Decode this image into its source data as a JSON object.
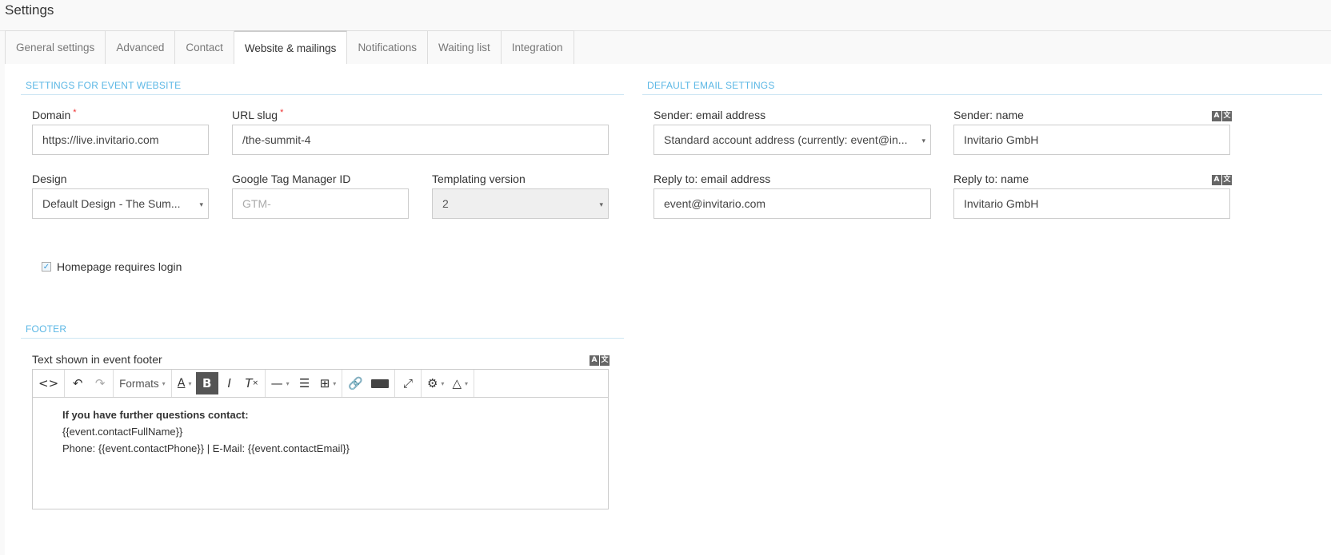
{
  "page": {
    "title": "Settings"
  },
  "tabs": [
    {
      "label": "General settings",
      "active": false
    },
    {
      "label": "Advanced",
      "active": false
    },
    {
      "label": "Contact",
      "active": false
    },
    {
      "label": "Website & mailings",
      "active": true
    },
    {
      "label": "Notifications",
      "active": false
    },
    {
      "label": "Waiting list",
      "active": false
    },
    {
      "label": "Integration",
      "active": false
    }
  ],
  "website": {
    "section_title": "SETTINGS FOR EVENT WEBSITE",
    "domain": {
      "label": "Domain",
      "required_mark": "*",
      "value": "https://live.invitario.com"
    },
    "url_slug": {
      "label": "URL slug",
      "required_mark": "*",
      "value": "/the-summit-4"
    },
    "design": {
      "label": "Design",
      "value": "Default Design - The Sum..."
    },
    "gtm": {
      "label": "Google Tag Manager ID",
      "placeholder": "GTM-"
    },
    "templating": {
      "label": "Templating version",
      "value": "2"
    },
    "homepage_login": {
      "label": "Homepage requires login",
      "checked": true
    }
  },
  "email": {
    "section_title": "DEFAULT EMAIL SETTINGS",
    "sender_email": {
      "label": "Sender: email address",
      "value": "Standard account address (currently: event@in..."
    },
    "sender_name": {
      "label": "Sender: name",
      "value": "Invitario GmbH"
    },
    "reply_email": {
      "label": "Reply to: email address",
      "value": "event@invitario.com"
    },
    "reply_name": {
      "label": "Reply to: name",
      "value": "Invitario GmbH"
    }
  },
  "footer": {
    "section_title": "FOOTER",
    "field_label": "Text shown in event footer",
    "toolbar": {
      "formats_label": "Formats"
    },
    "content": {
      "line1": "If you have further questions contact:",
      "line2": "{{event.contactFullName}}",
      "line3": "Phone: {{event.contactPhone}} | E-Mail: {{event.contactEmail}}"
    }
  },
  "icons": {
    "translate": [
      "A",
      "文"
    ],
    "check": "✓",
    "caret": "▾"
  },
  "colors": {
    "section_title": "#5bb7e5",
    "required": "#e33333",
    "active_tool": "#555555"
  }
}
